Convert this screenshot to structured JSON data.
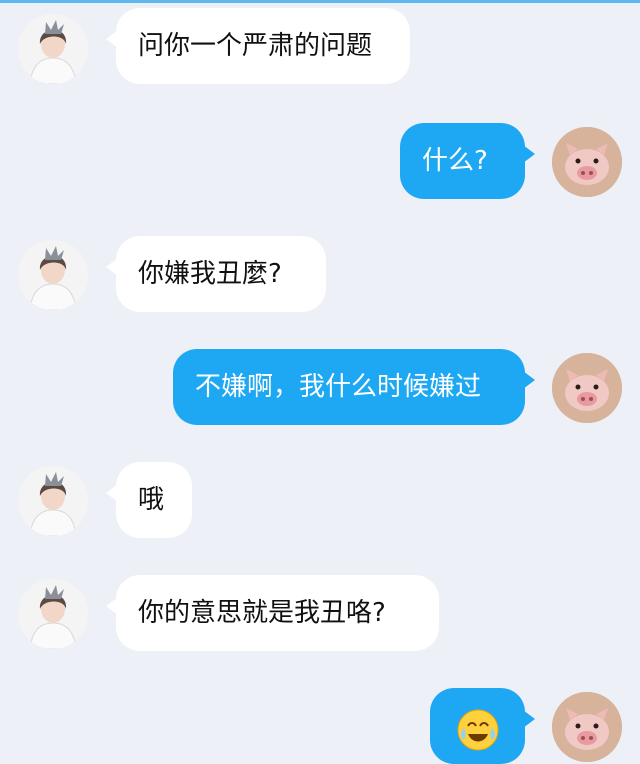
{
  "chat": {
    "messages": [
      {
        "side": "left",
        "sender": "girl",
        "text": "问你一个严肃的问题"
      },
      {
        "side": "right",
        "sender": "pig",
        "text": "什么?"
      },
      {
        "side": "left",
        "sender": "girl",
        "text": "你嫌我丑麼?"
      },
      {
        "side": "right",
        "sender": "pig",
        "text": "不嫌啊，我什么时候嫌过"
      },
      {
        "side": "left",
        "sender": "girl",
        "text": "哦"
      },
      {
        "side": "left",
        "sender": "girl",
        "text": "你的意思就是我丑咯?"
      },
      {
        "side": "right",
        "sender": "pig",
        "text": "",
        "emoji": "crying-laughing-face-icon"
      }
    ]
  },
  "colors": {
    "background": "#eef0f7",
    "incoming_bubble": "#ffffff",
    "outgoing_bubble": "#1ea8f3",
    "outgoing_text": "#ffffff",
    "incoming_text": "#111111"
  }
}
